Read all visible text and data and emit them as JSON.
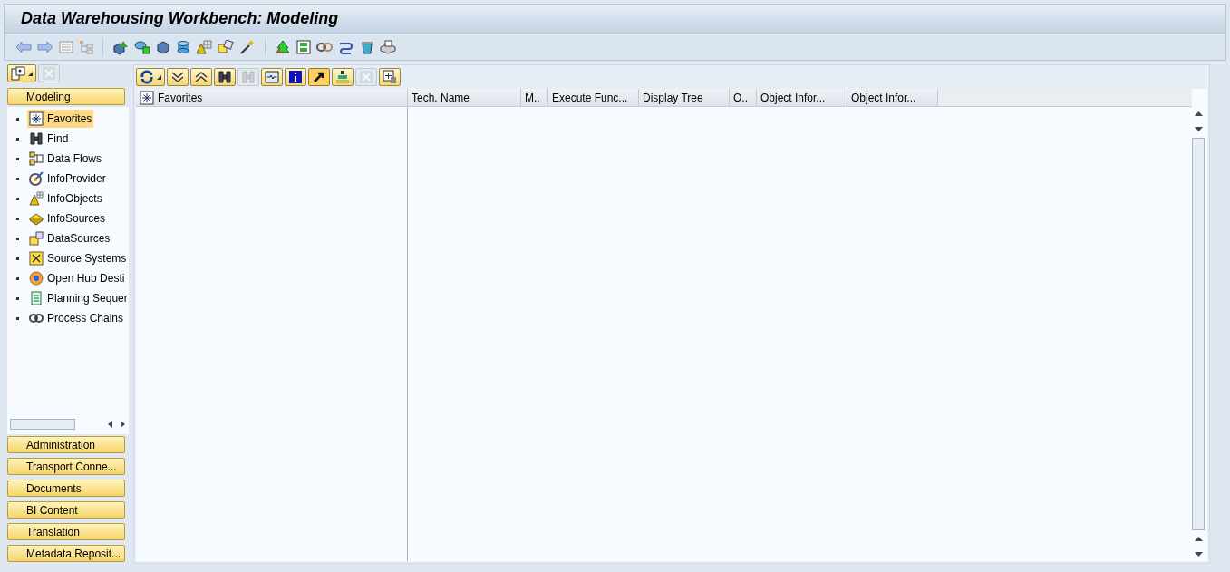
{
  "window": {
    "title": "Data Warehousing Workbench: Modeling"
  },
  "left_toolbar": [
    {
      "kind": "layout",
      "has_menu": true,
      "disabled": false
    },
    {
      "kind": "close",
      "has_menu": false,
      "disabled": true
    }
  ],
  "modeling_section": {
    "label": "Modeling"
  },
  "tree": {
    "items": [
      {
        "label": "Favorites",
        "kind": "favorites",
        "selected": true
      },
      {
        "label": "Find",
        "kind": "find",
        "selected": false
      },
      {
        "label": "Data Flows",
        "kind": "dataflow",
        "selected": false
      },
      {
        "label": "InfoProvider",
        "kind": "provider",
        "selected": false
      },
      {
        "label": "InfoObjects",
        "kind": "infoobject",
        "selected": false
      },
      {
        "label": "InfoSources",
        "kind": "infosource",
        "selected": false
      },
      {
        "label": "DataSources",
        "kind": "datasource",
        "selected": false
      },
      {
        "label": "Source Systems",
        "kind": "sourcesys",
        "selected": false
      },
      {
        "label": "Open Hub Desti",
        "kind": "openhub",
        "selected": false
      },
      {
        "label": "Planning Sequer",
        "kind": "planning",
        "selected": false
      },
      {
        "label": "Process Chains",
        "kind": "chain",
        "selected": false
      }
    ]
  },
  "sections": [
    {
      "label": "Administration"
    },
    {
      "label": "Transport Conne..."
    },
    {
      "label": "Documents"
    },
    {
      "label": "BI Content"
    },
    {
      "label": "Translation"
    },
    {
      "label": "Metadata Reposit..."
    }
  ],
  "panel_toolbar": [
    {
      "kind": "refresh",
      "has_menu": true,
      "disabled": false,
      "pressed": false
    },
    {
      "kind": "expand",
      "has_menu": false,
      "disabled": false,
      "pressed": false
    },
    {
      "kind": "collapse",
      "has_menu": false,
      "disabled": false,
      "pressed": false
    },
    {
      "kind": "find",
      "has_menu": false,
      "disabled": false,
      "pressed": false
    },
    {
      "kind": "findnext",
      "has_menu": false,
      "disabled": true,
      "pressed": false
    },
    {
      "kind": "display",
      "has_menu": false,
      "disabled": false,
      "pressed": false
    },
    {
      "kind": "info",
      "has_menu": false,
      "disabled": false,
      "pressed": false
    },
    {
      "kind": "link",
      "has_menu": false,
      "disabled": false,
      "pressed": true
    },
    {
      "kind": "hierarchy",
      "has_menu": false,
      "disabled": false,
      "pressed": false
    },
    {
      "kind": "close",
      "has_menu": false,
      "disabled": true,
      "pressed": false
    },
    {
      "kind": "favorites-remove",
      "has_menu": false,
      "disabled": false,
      "pressed": false
    }
  ],
  "table": {
    "columns": [
      {
        "label": "Favorites",
        "kind": "tree"
      },
      {
        "label": "Tech. Name",
        "kind": "plain"
      },
      {
        "label": "M..",
        "kind": "plain"
      },
      {
        "label": "Execute Func...",
        "kind": "plain"
      },
      {
        "label": "Display Tree",
        "kind": "plain"
      },
      {
        "label": "O..",
        "kind": "plain"
      },
      {
        "label": "Object Infor...",
        "kind": "plain"
      },
      {
        "label": "Object Infor...",
        "kind": "plain"
      }
    ]
  }
}
